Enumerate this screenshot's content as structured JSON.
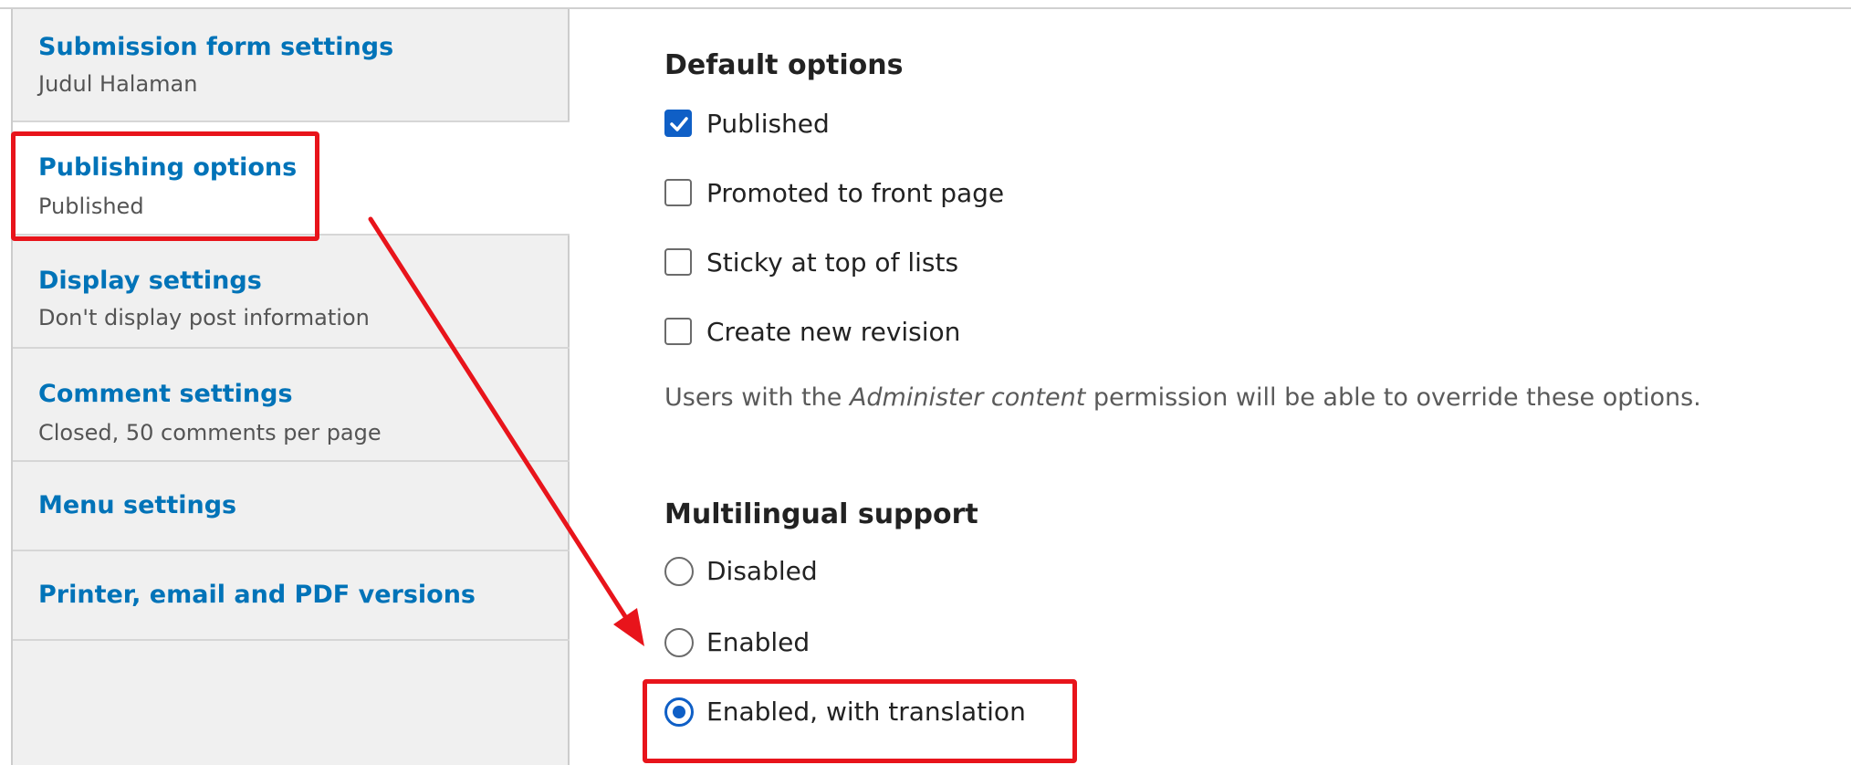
{
  "vertical_tabs": [
    {
      "title": "Submission form settings",
      "summary": "Judul Halaman"
    },
    {
      "title": "Publishing options",
      "summary": "Published"
    },
    {
      "title": "Display settings",
      "summary": "Don't display post information"
    },
    {
      "title": "Comment settings",
      "summary": "Closed, 50 comments per page"
    },
    {
      "title": "Menu settings",
      "summary": ""
    },
    {
      "title": "Printer, email and PDF versions",
      "summary": ""
    }
  ],
  "default_options": {
    "heading": "Default options",
    "items": [
      {
        "label": "Published",
        "checked": true
      },
      {
        "label": "Promoted to front page",
        "checked": false
      },
      {
        "label": "Sticky at top of lists",
        "checked": false
      },
      {
        "label": "Create new revision",
        "checked": false
      }
    ],
    "description_prefix": "Users with the ",
    "description_em": "Administer content",
    "description_suffix": " permission will be able to override these options."
  },
  "multilingual": {
    "heading": "Multilingual support",
    "options": [
      {
        "label": "Disabled",
        "selected": false
      },
      {
        "label": "Enabled",
        "selected": false
      },
      {
        "label": "Enabled, with translation",
        "selected": true
      }
    ]
  },
  "annotation_color": "#e8141b",
  "accent_color": "#0f5fc6",
  "link_color": "#0073b8"
}
